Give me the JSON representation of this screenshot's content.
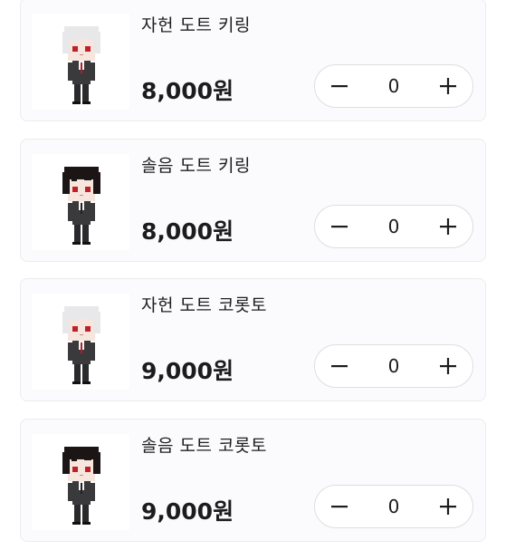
{
  "products": [
    {
      "name": "자헌 도트 키링",
      "price": "8,000원",
      "quantity": "0",
      "thumbnail_icon": "white-hair-chibi-icon",
      "hair_color": "#e8e8ea",
      "minus_label": "−",
      "plus_label": "+"
    },
    {
      "name": "솔음 도트 키링",
      "price": "8,000원",
      "quantity": "0",
      "thumbnail_icon": "black-hair-chibi-icon",
      "hair_color": "#1c1516",
      "minus_label": "−",
      "plus_label": "+"
    },
    {
      "name": "자헌 도트 코롯토",
      "price": "9,000원",
      "quantity": "0",
      "thumbnail_icon": "white-hair-chibi-icon",
      "hair_color": "#e8e8ea",
      "minus_label": "−",
      "plus_label": "+"
    },
    {
      "name": "솔음 도트 코롯토",
      "price": "9,000원",
      "quantity": "0",
      "thumbnail_icon": "black-hair-chibi-icon",
      "hair_color": "#1c1516",
      "minus_label": "−",
      "plus_label": "+"
    }
  ],
  "colors": {
    "card_background": "#fbfafc",
    "card_border": "#ececf0",
    "stepper_border": "#dedee3",
    "eye_red": "#c0202a",
    "suit": "#3a3a3d"
  }
}
